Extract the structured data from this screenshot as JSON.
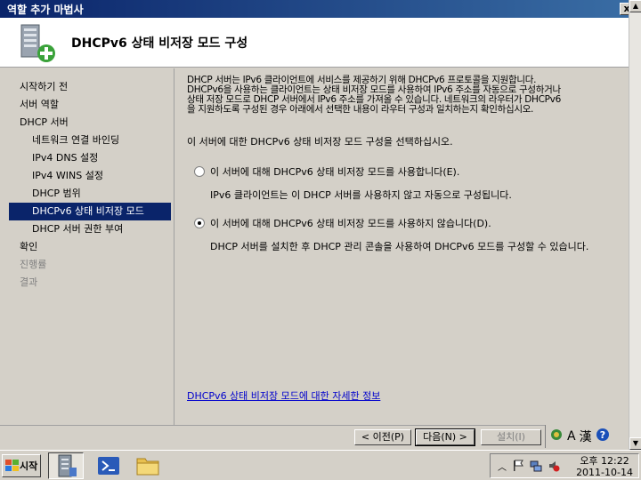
{
  "window": {
    "title": "역할 추가 마법사",
    "close_label": "x"
  },
  "header": {
    "heading": "DHCPv6 상태 비저장 모드 구성"
  },
  "nav": {
    "items": [
      {
        "label": "시작하기 전",
        "level": 0,
        "state": "normal"
      },
      {
        "label": "서버 역할",
        "level": 0,
        "state": "normal"
      },
      {
        "label": "DHCP 서버",
        "level": 0,
        "state": "normal"
      },
      {
        "label": "네트워크 연결 바인딩",
        "level": 1,
        "state": "normal"
      },
      {
        "label": "IPv4 DNS 설정",
        "level": 1,
        "state": "normal"
      },
      {
        "label": "IPv4 WINS 설정",
        "level": 1,
        "state": "normal"
      },
      {
        "label": "DHCP 범위",
        "level": 1,
        "state": "normal"
      },
      {
        "label": "DHCPv6 상태 비저장 모드",
        "level": 1,
        "state": "selected"
      },
      {
        "label": "DHCP 서버 권한 부여",
        "level": 1,
        "state": "normal"
      },
      {
        "label": "확인",
        "level": 0,
        "state": "normal"
      },
      {
        "label": "진행률",
        "level": 0,
        "state": "disabled"
      },
      {
        "label": "결과",
        "level": 0,
        "state": "disabled"
      }
    ]
  },
  "content": {
    "description_lines": [
      "DHCP 서버는 IPv6 클라이언트에 서비스를 제공하기 위해 DHCPv6 프로토콜을 지원합니다.",
      "DHCPv6을 사용하는 클라이언트는 상태 비저장 모드를 사용하여 IPv6 주소를 자동으로 구성하거나",
      "상태 저장 모드로 DHCP 서버에서 IPv6 주소를 가져올 수 있습니다. 네트워크의 라우터가 DHCPv6",
      "을 지원하도록 구성된 경우 아래에서 선택한 내용이 라우터 구성과 일치하는지 확인하십시오."
    ],
    "prompt": "이 서버에 대한 DHCPv6 상태 비저장 모드 구성을 선택하십시오.",
    "option_enable": {
      "label": "이 서버에 대해 DHCPv6 상태 비저장 모드를 사용합니다(E).",
      "detail": "IPv6 클라이언트는 이 DHCP 서버를 사용하지 않고 자동으로 구성됩니다.",
      "checked": false
    },
    "option_disable": {
      "label": "이 서버에 대해 DHCPv6 상태 비저장 모드를 사용하지 않습니다(D).",
      "detail": "DHCP 서버를 설치한 후 DHCP 관리 콘솔을 사용하여 DHCPv6 모드를 구성할 수 있습니다.",
      "checked": true
    },
    "more_info_link": "DHCPv6 상태 비저장 모드에 대한 자세한 정보"
  },
  "buttons": {
    "prev": "< 이전(P)",
    "next": "다음(N) >",
    "install": "설치(I)"
  },
  "langbar": {
    "char_a": "A",
    "char_han": "漢",
    "help": "?"
  },
  "taskbar": {
    "start_label": "시작",
    "clock_period": "오후 12:22",
    "clock_date": "2011-10-14"
  },
  "colors": {
    "selected_bg": "#0a246a",
    "link": "#0000cc",
    "title_bg": "#0a246a"
  }
}
